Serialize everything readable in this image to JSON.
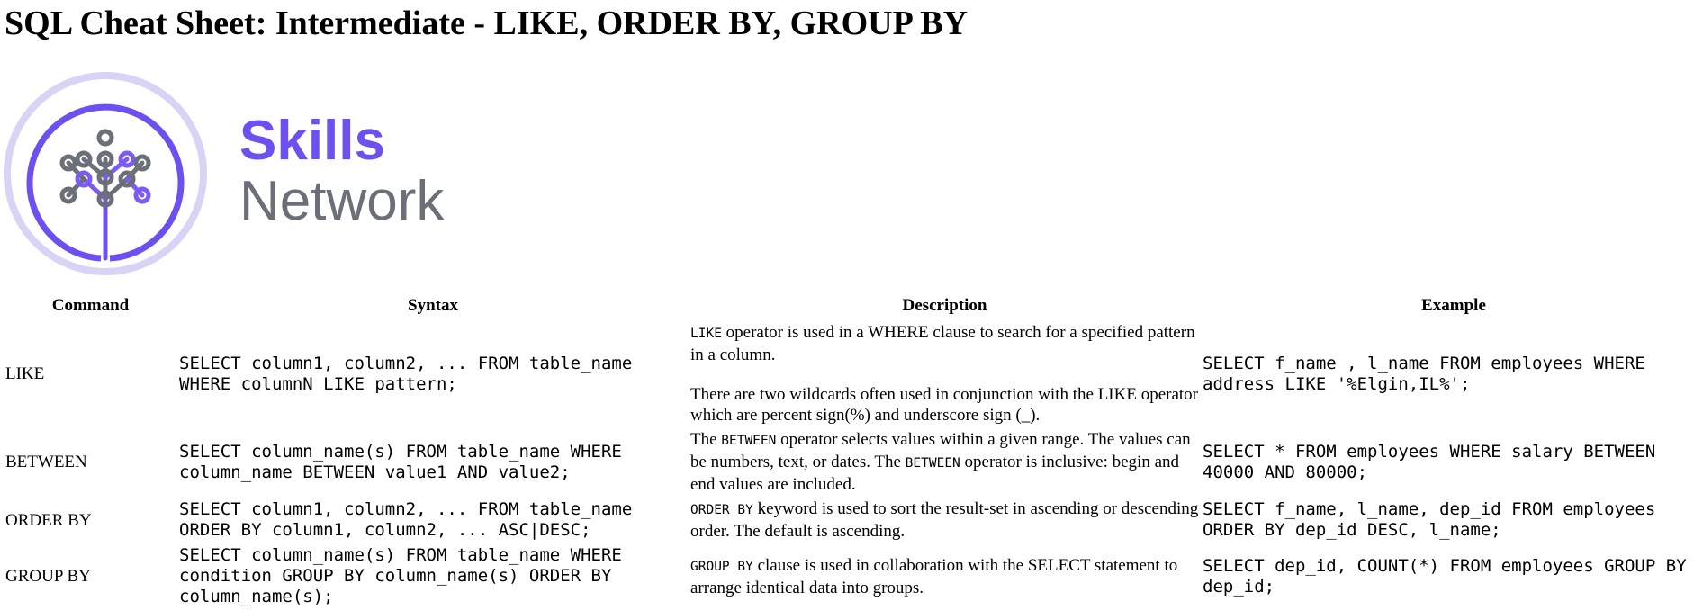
{
  "page": {
    "title": "SQL Cheat Sheet: Intermediate - LIKE, ORDER BY, GROUP BY"
  },
  "logo": {
    "line1": "Skills",
    "line2": "Network",
    "ring_outer_color": "#d9d3f5",
    "ring_inner_color": "#6e4ff0",
    "icon_gray": "#6b6f78",
    "icon_purple": "#7c5cf0",
    "text_purple": "#6e4ff0",
    "text_gray": "#6b6f78"
  },
  "table": {
    "headers": [
      "Command",
      "Syntax",
      "Description",
      "Example"
    ],
    "rows": [
      {
        "command": "LIKE",
        "syntax": "SELECT column1, column2, ... FROM table_name WHERE columnN LIKE pattern;",
        "description": [
          {
            "code": "LIKE",
            "text": " operator is used in a WHERE clause to search for a specified pattern in a column."
          },
          {
            "code": "",
            "text": "There are two wildcards often used in conjunction with the LIKE operator which are percent sign(%) and underscore sign (_)."
          }
        ],
        "example": "SELECT f_name , l_name FROM employees WHERE address LIKE '%Elgin,IL%';"
      },
      {
        "command": "BETWEEN",
        "syntax": "SELECT column_name(s) FROM table_name WHERE column_name BETWEEN value1 AND value2;",
        "description_parts": {
          "p1": "The ",
          "code1": "BETWEEN",
          "p2": " operator selects values within a given range. The values can be numbers, text, or dates. The ",
          "code2": "BETWEEN",
          "p3": " operator is inclusive: begin and end values are included."
        },
        "example": "SELECT * FROM employees WHERE salary BETWEEN 40000 AND 80000;"
      },
      {
        "command": "ORDER BY",
        "syntax": "SELECT column1, column2, ... FROM table_name ORDER BY column1, column2, ... ASC|DESC;",
        "description": [
          {
            "code": "ORDER BY",
            "text": " keyword is used to sort the result-set in ascending or descending order. The default is ascending."
          }
        ],
        "example": "SELECT f_name, l_name, dep_id FROM employees ORDER BY dep_id DESC, l_name;"
      },
      {
        "command": "GROUP BY",
        "syntax": "SELECT column_name(s) FROM table_name WHERE condition GROUP BY column_name(s) ORDER BY column_name(s);",
        "description": [
          {
            "code": "GROUP BY",
            "text": " clause is used in collaboration with the SELECT statement to arrange identical data into groups."
          }
        ],
        "example": "SELECT dep_id, COUNT(*) FROM employees GROUP BY dep_id;"
      }
    ]
  }
}
